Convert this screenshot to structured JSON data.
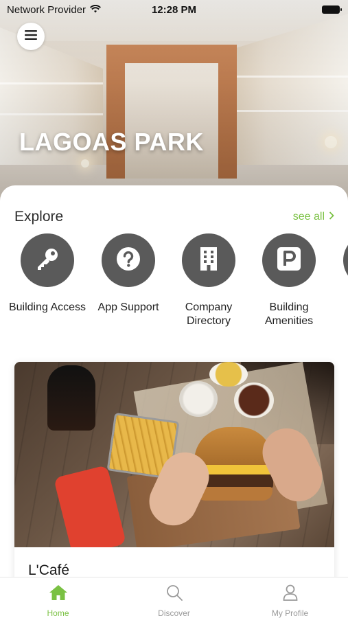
{
  "status_bar": {
    "carrier": "Network Provider",
    "time": "12:28 PM"
  },
  "hero": {
    "title": "LAGOAS PARK"
  },
  "explore": {
    "title": "Explore",
    "see_all": "see all"
  },
  "tiles": [
    {
      "label": "Building Access",
      "icon": "key-icon"
    },
    {
      "label": "App Support",
      "icon": "question-icon"
    },
    {
      "label": "Company Directory",
      "icon": "building-icon"
    },
    {
      "label": "Building Amenities",
      "icon": "parking-icon"
    }
  ],
  "card": {
    "title": "L'Café"
  },
  "tabbar": {
    "items": [
      {
        "label": "Home",
        "icon": "home-icon",
        "active": true
      },
      {
        "label": "Discover",
        "icon": "search-icon",
        "active": false
      },
      {
        "label": "My Profile",
        "icon": "user-icon",
        "active": false
      }
    ]
  },
  "colors": {
    "accent": "#7ac143",
    "tile_bg": "#5a5a5a",
    "tab_inactive": "#9a9a9a"
  }
}
